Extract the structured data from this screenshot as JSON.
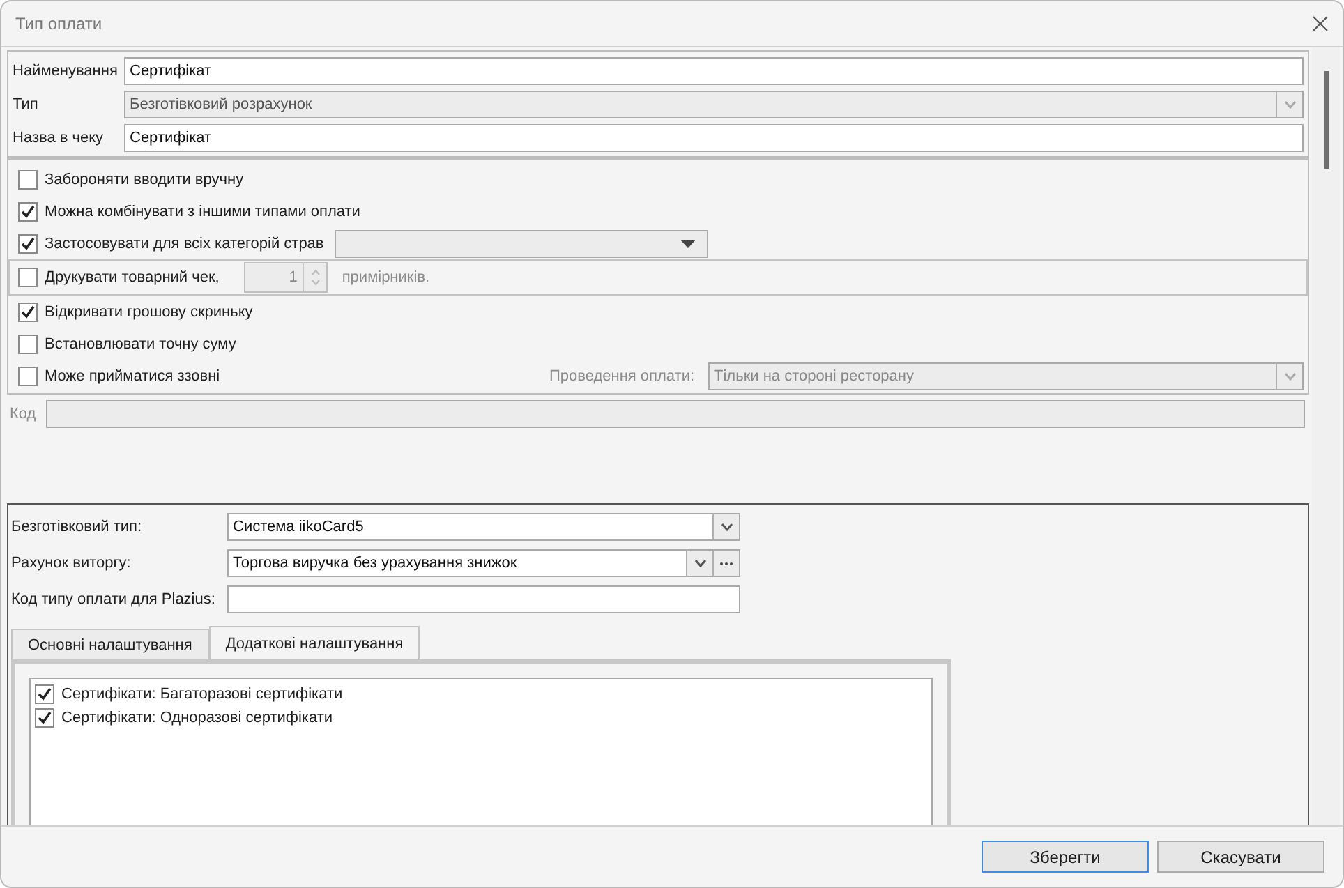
{
  "window": {
    "title": "Тип оплати"
  },
  "fields": [
    {
      "label": "Найменування",
      "value": "Сертифікат",
      "kind": "text"
    },
    {
      "label": "Тип",
      "value": "Безготівковий розрахунок",
      "kind": "combo"
    },
    {
      "label": "Назва в чеку",
      "value": "Сертифікат",
      "kind": "text"
    }
  ],
  "options": [
    {
      "kind": "plain",
      "label": "Забороняти вводити вручну",
      "checked": false
    },
    {
      "kind": "plain",
      "label": "Можна комбінувати з іншими типами оплати",
      "checked": true
    },
    {
      "kind": "dropdown",
      "label": "Застосовувати для всіх категорій страв",
      "checked": true
    },
    {
      "kind": "copies",
      "label": "Друкувати товарний чек,",
      "checked": false,
      "count": "1",
      "suffix": "примірників."
    },
    {
      "kind": "plain",
      "label": "Відкривати грошову скриньку",
      "checked": true
    },
    {
      "kind": "plain",
      "label": "Встановлювати точну суму",
      "checked": false
    },
    {
      "kind": "payment",
      "label": "Може прийматися ззовні",
      "checked": false,
      "side_label": "Проведення оплати:",
      "side_value": "Тільки на стороні ресторану"
    }
  ],
  "code": {
    "label": "Код"
  },
  "settings": [
    {
      "label": "Безготівковий тип:",
      "value": "Система iikoCard5",
      "kind": "combo"
    },
    {
      "label": "Рахунок виторгу:",
      "value": "Торгова виручка без урахування знижок",
      "kind": "combo_more"
    },
    {
      "label": "Код типу оплати для Plazius:",
      "kind": "text"
    }
  ],
  "tabs": [
    {
      "label": "Основні налаштування",
      "selected": false
    },
    {
      "label": "Додаткові налаштування",
      "selected": true
    }
  ],
  "certificates": [
    {
      "label": "Сертифікати: Багаторазові сертифікати",
      "checked": true
    },
    {
      "label": "Сертифікати: Одноразові сертифікати",
      "checked": true
    }
  ],
  "buttons": [
    {
      "label": "Зберегти",
      "focused": true
    },
    {
      "label": "Скасувати",
      "focused": false
    }
  ]
}
